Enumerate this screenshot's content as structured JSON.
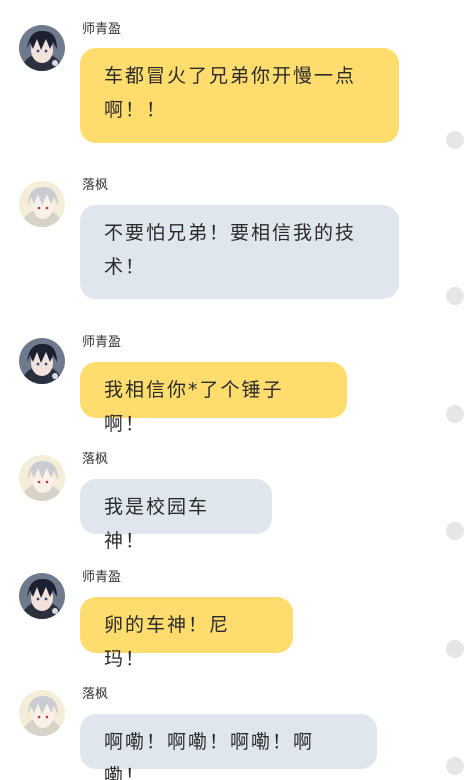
{
  "colors": {
    "yellow_bubble": "#fedd6e",
    "grey_bubble": "#dfe6ee",
    "status_dot": "#e6e6e6"
  },
  "messages": [
    {
      "sender": "师青盈",
      "text": "车都冒火了兄弟你开慢一点啊！！",
      "bubble": "yellow",
      "avatar": "dark-hair-avatar"
    },
    {
      "sender": "落枫",
      "text": "不要怕兄弟！要相信我的技术！",
      "bubble": "grey",
      "avatar": "silver-hair-avatar"
    },
    {
      "sender": "师青盈",
      "text": "我相信你*了个锤子啊！",
      "bubble": "yellow",
      "avatar": "dark-hair-avatar"
    },
    {
      "sender": "落枫",
      "text": "我是校园车神！",
      "bubble": "grey",
      "avatar": "silver-hair-avatar"
    },
    {
      "sender": "师青盈",
      "text": "卵的车神！尼玛！",
      "bubble": "yellow",
      "avatar": "dark-hair-avatar"
    },
    {
      "sender": "落枫",
      "text": "啊嘞！啊嘞！啊嘞！啊嘞！",
      "bubble": "grey",
      "avatar": "silver-hair-avatar"
    }
  ]
}
